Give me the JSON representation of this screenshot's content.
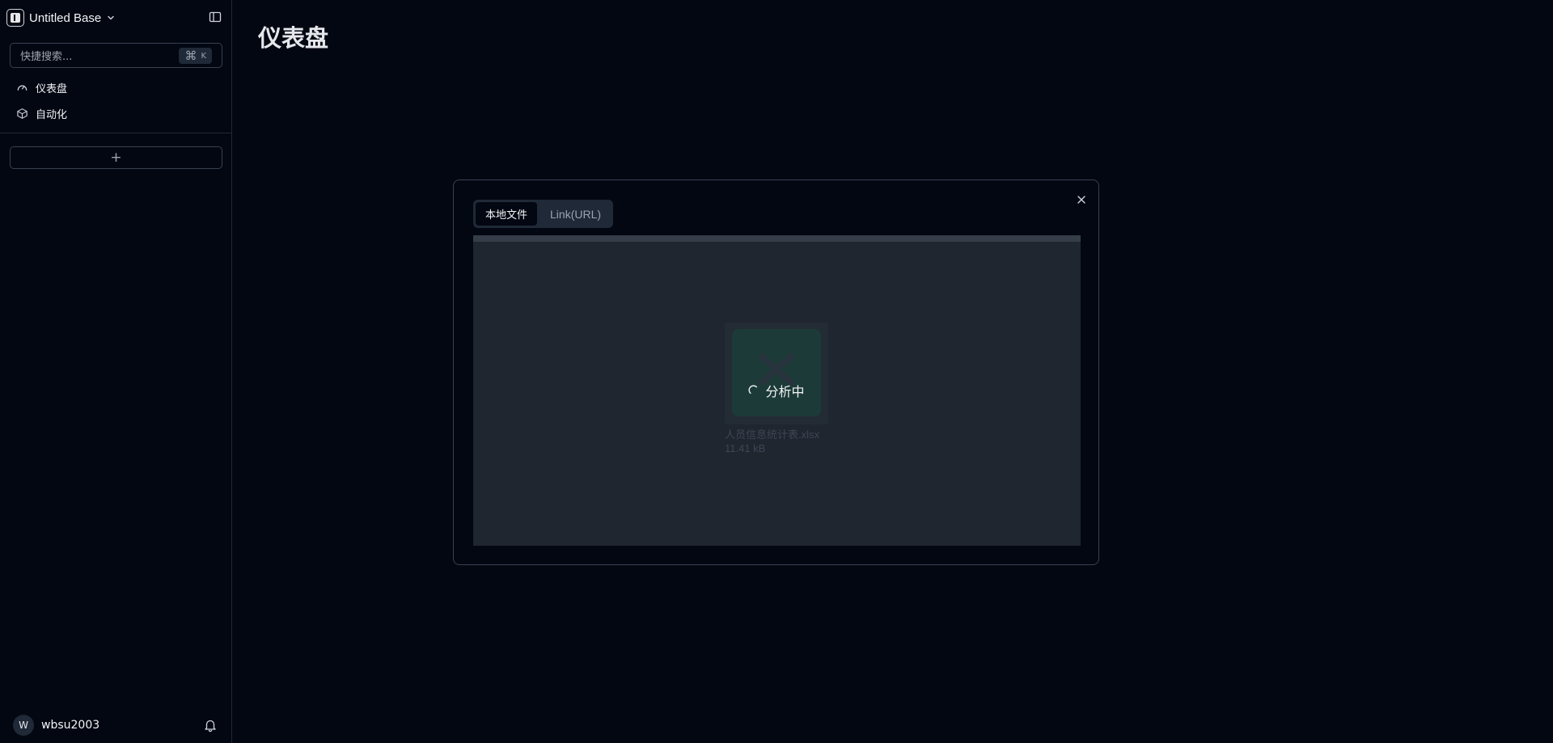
{
  "sidebar": {
    "base_title": "Untitled Base",
    "search": {
      "placeholder": "快捷搜索...",
      "shortcut_cmd": "⌘",
      "shortcut_key": "K"
    },
    "nav": [
      {
        "label": "仪表盘",
        "icon": "gauge-icon"
      },
      {
        "label": "自动化",
        "icon": "box-icon"
      }
    ],
    "add_table_label": "+",
    "user": {
      "avatar_initial": "W",
      "name": "wbsu2003"
    }
  },
  "main": {
    "title": "仪表盘"
  },
  "modal": {
    "tabs": [
      {
        "label": "本地文件",
        "active": true
      },
      {
        "label": "Link(URL)",
        "active": false
      }
    ],
    "file": {
      "status": "分析中",
      "name": "人员信息统计表.xlsx",
      "size": "11.41 kB",
      "upload_progress": 1.0
    }
  },
  "colors": {
    "background": "#030712",
    "border": "#374151",
    "dropzone": "#1f2630",
    "file_thumb": "#1c3b38"
  }
}
